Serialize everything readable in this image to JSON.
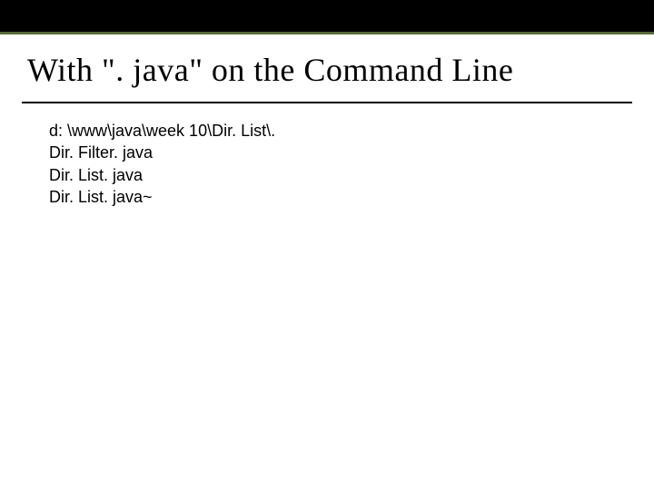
{
  "title": "With \". java\" on the Command Line",
  "code": {
    "line1": "d: \\www\\java\\week 10\\Dir. List\\.",
    "line2": "Dir. Filter. java",
    "line3": "Dir. List. java",
    "line4": "Dir. List. java~"
  }
}
